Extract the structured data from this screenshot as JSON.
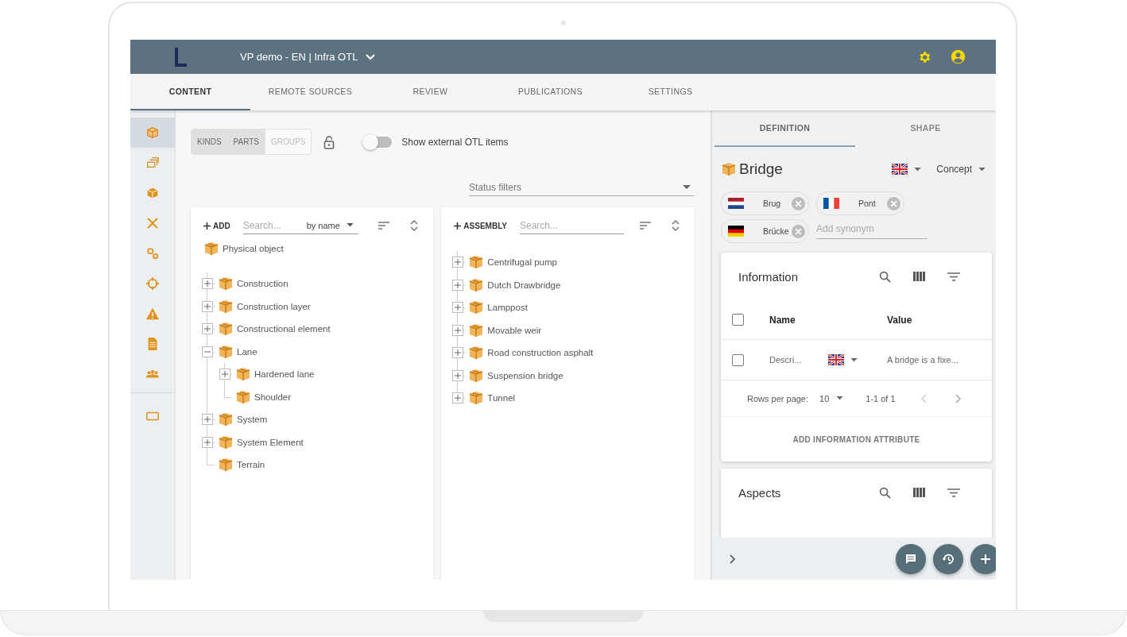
{
  "app_bar": {
    "title": "VP demo - EN | Infra OTL"
  },
  "tabs": [
    {
      "label": "CONTENT",
      "selected": true
    },
    {
      "label": "REMOTE SOURCES",
      "selected": false
    },
    {
      "label": "REVIEW",
      "selected": false
    },
    {
      "label": "PUBLICATIONS",
      "selected": false
    },
    {
      "label": "SETTINGS",
      "selected": false
    }
  ],
  "rail": [
    {
      "kind": "cube",
      "selected": true
    },
    {
      "kind": "layers",
      "selected": false
    },
    {
      "kind": "solid",
      "selected": false
    },
    {
      "kind": "tools",
      "selected": false
    },
    {
      "kind": "gears",
      "selected": false
    },
    {
      "kind": "crosshair",
      "selected": false
    },
    {
      "kind": "warning",
      "selected": false
    },
    {
      "kind": "document",
      "selected": false
    },
    {
      "kind": "people",
      "selected": false
    },
    {
      "kind": "card",
      "selected": false
    }
  ],
  "view_toggle": [
    {
      "label": "KINDS",
      "selected": true
    },
    {
      "label": "PARTS",
      "selected": true
    },
    {
      "label": "GROUPS",
      "selected": false
    }
  ],
  "external_switch": {
    "label": "Show external OTL items",
    "on": false
  },
  "status_filter": {
    "placeholder": "Status filters"
  },
  "kinds_panel": {
    "add_label": "ADD",
    "search_placeholder": "Search...",
    "sort_by": "by name",
    "root": "Physical object",
    "items": [
      {
        "label": "Construction",
        "kind": "branch",
        "expanded": false
      },
      {
        "label": "Construction layer",
        "kind": "branch",
        "expanded": false
      },
      {
        "label": "Constructional element",
        "kind": "branch",
        "expanded": false
      },
      {
        "label": "Lane",
        "kind": "branch",
        "expanded": true,
        "children": [
          {
            "label": "Hardened lane",
            "kind": "branch",
            "expanded": false
          },
          {
            "label": "Shoulder",
            "kind": "leaf"
          }
        ]
      },
      {
        "label": "System",
        "kind": "branch",
        "expanded": false
      },
      {
        "label": "System Element",
        "kind": "branch",
        "expanded": false
      },
      {
        "label": "Terrain",
        "kind": "leaf"
      }
    ]
  },
  "assembly_panel": {
    "add_label": "ASSEMBLY",
    "search_placeholder": "Search...",
    "items": [
      {
        "label": "Centrifugal pump",
        "kind": "branch",
        "expanded": false
      },
      {
        "label": "Dutch Drawbridge",
        "kind": "branch",
        "expanded": false
      },
      {
        "label": "Lamppost",
        "kind": "branch",
        "expanded": false
      },
      {
        "label": "Movable weir",
        "kind": "branch",
        "expanded": false
      },
      {
        "label": "Road construction asphalt",
        "kind": "branch",
        "expanded": false
      },
      {
        "label": "Suspension bridge",
        "kind": "branch",
        "expanded": false
      },
      {
        "label": "Tunnel",
        "kind": "branch",
        "expanded": false
      }
    ]
  },
  "detail_tabs": [
    {
      "label": "DEFINITION",
      "selected": true
    },
    {
      "label": "SHAPE",
      "selected": false
    }
  ],
  "concept": {
    "title": "Bridge",
    "type": "Concept"
  },
  "synonyms": [
    {
      "label": "Brug",
      "kind": "nl"
    },
    {
      "label": "Pont",
      "kind": "fr"
    },
    {
      "label": "Brücke",
      "kind": "de"
    }
  ],
  "synonym_field": {
    "placeholder": "Add synonym"
  },
  "information": {
    "title": "Information",
    "columns": [
      "Name",
      "Value"
    ],
    "header_checked": false,
    "rows": [
      {
        "name": "Descri...",
        "value": "A bridge is a fixe...",
        "checked": false
      }
    ],
    "rows_per_page_label": "Rows per page:",
    "rows_per_page": "10",
    "range": "1-1 of 1",
    "add_button": "ADD INFORMATION ATTRIBUTE"
  },
  "aspects": {
    "title": "Aspects"
  }
}
